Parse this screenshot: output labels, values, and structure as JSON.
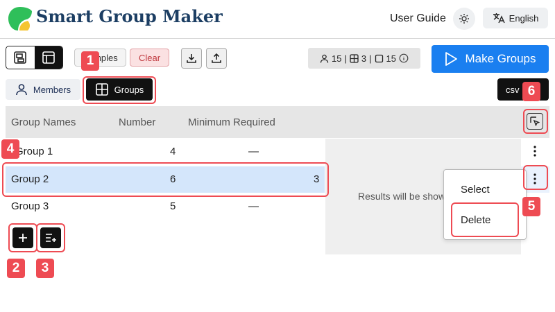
{
  "header": {
    "title": "Smart Group Maker",
    "user_guide": "User Guide",
    "language": "English",
    "logo_icon": "leaf-logo-icon",
    "theme_icon": "sun-icon",
    "translate_icon": "translate-icon"
  },
  "toolbar": {
    "samples_label": "Samples",
    "clear_label": "Clear",
    "stats": {
      "members": "15",
      "groups": "3",
      "seats": "15"
    },
    "make_groups_label": "Make Groups"
  },
  "tabs": {
    "members_label": "Members",
    "groups_label": "Groups",
    "csv_label": "csv"
  },
  "table": {
    "headers": {
      "name": "Group Names",
      "number": "Number",
      "minimum": "Minimum Required"
    },
    "rows": [
      {
        "name": "Group 1",
        "number": "4",
        "minimum": "—"
      },
      {
        "name": "Group 2",
        "number": "6",
        "minimum": "3"
      },
      {
        "name": "Group 3",
        "number": "5",
        "minimum": "—"
      }
    ]
  },
  "results": {
    "placeholder": "Results will be shown here"
  },
  "context_menu": {
    "select_label": "Select",
    "delete_label": "Delete"
  },
  "annotations": [
    "1",
    "2",
    "3",
    "4",
    "5",
    "6"
  ],
  "colors": {
    "primary": "#1a7ff0",
    "annotation": "#ee4b53",
    "selected_row": "#d4e6fb",
    "title": "#1c3e63"
  }
}
